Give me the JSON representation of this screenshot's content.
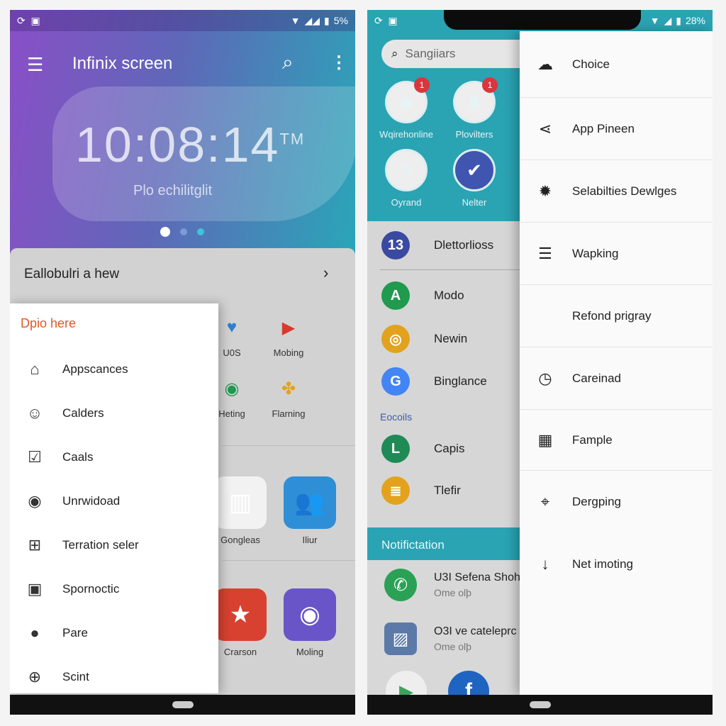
{
  "left": {
    "status": {
      "left_icons": [
        "sync-icon",
        "image-icon"
      ],
      "battery": "5%"
    },
    "header": {
      "title": "Infinix screen",
      "clock": "10:08:14",
      "clock_suffix": "TM",
      "subtitle": "Plo echilitglit",
      "page_dots": 3,
      "active_dot": 0
    },
    "card": {
      "title": "Eallobulri a hew"
    },
    "apps": [
      {
        "label": "U0S",
        "icon": "heart-icon",
        "color": "#2f7fd0"
      },
      {
        "label": "Mobing",
        "icon": "youtube-bag-icon",
        "color": "#d83a2f"
      },
      {
        "label": "Heting",
        "icon": "camera-icon",
        "color": "#1f9a4e"
      },
      {
        "label": "Flarning",
        "icon": "pinwheel-icon",
        "color": "#e2a21d"
      },
      {
        "label": "Gongleas",
        "icon": "chart-icon",
        "color": "#f2f2f2"
      },
      {
        "label": "Iliur",
        "icon": "contacts-icon",
        "color": "#2e8fd6"
      },
      {
        "label": "Crarson",
        "icon": "star-icon",
        "color": "#d8412f"
      },
      {
        "label": "Moling",
        "icon": "camera-icon",
        "color": "#6a55c8"
      }
    ],
    "drawer": {
      "heading": "Dpio here",
      "accent": "#e0582a",
      "items": [
        {
          "label": "Appscances",
          "icon": "bag-icon"
        },
        {
          "label": "Calders",
          "icon": "smiley-icon"
        },
        {
          "label": "Caals",
          "icon": "checkbox-icon"
        },
        {
          "label": "Unrwidoad",
          "icon": "camera-icon"
        },
        {
          "label": "Terration seler",
          "icon": "add-box-icon"
        },
        {
          "label": "Spornoctic",
          "icon": "frame-icon"
        },
        {
          "label": "Pare",
          "icon": "person-icon"
        },
        {
          "label": "Scint",
          "icon": "add-shield-icon"
        }
      ]
    }
  },
  "right": {
    "status": {
      "left_icons": [
        "sync-icon",
        "image-icon"
      ],
      "battery": "28%"
    },
    "search": {
      "placeholder": "Sangiiars"
    },
    "contacts": [
      {
        "label": "Wqirehonline",
        "badge": "1"
      },
      {
        "label": "Plovilters",
        "badge": "1"
      },
      {
        "label": "Oyrand"
      },
      {
        "label": "Nelter"
      }
    ],
    "list": [
      {
        "label": "Dlettorlioss",
        "icon": "13",
        "color": "#3a4aa0"
      },
      {
        "label": "Modo",
        "icon": "A",
        "color": "#1f9a4e"
      },
      {
        "label": "Newin",
        "icon": "chrome-icon",
        "color": "#e2a21d"
      },
      {
        "label": "Binglance",
        "icon": "G",
        "color": "#4285f4"
      }
    ],
    "section": "Eocoils",
    "list2": [
      {
        "label": "Capis",
        "icon": "L",
        "color": "#1f8a55"
      },
      {
        "label": "Tlefir",
        "icon": "note-icon",
        "color": "#e2a21d"
      }
    ],
    "notification_header": "Notifictation",
    "notifications": [
      {
        "title": "U3I Sefena Shoh",
        "sub": "Ome olþ",
        "icon": "phone-icon",
        "color": "#2aa155"
      },
      {
        "title": "O3I ve cateleprc",
        "sub": "Ome olþ",
        "icon": "photo-icon",
        "color": "#5b7aa8"
      }
    ],
    "menu": [
      {
        "label": "Choice",
        "icon": "cloud-icon"
      },
      {
        "label": "App Pineen",
        "icon": "share-icon"
      },
      {
        "label": "Selabilties Dewlges",
        "icon": "gear-icon"
      },
      {
        "label": "Wapking",
        "icon": "menu-box-icon"
      },
      {
        "label": "Refond prigray",
        "icon": "apple-icon"
      },
      {
        "label": "Careinad",
        "icon": "clock-icon"
      },
      {
        "label": "Fample",
        "icon": "qr-icon"
      },
      {
        "label": "Dergping",
        "icon": "location-icon"
      },
      {
        "label": "Net imoting",
        "icon": "download-icon"
      }
    ]
  }
}
